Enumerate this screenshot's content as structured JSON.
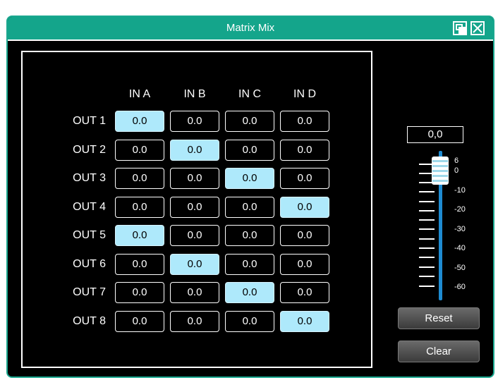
{
  "window": {
    "title": "Matrix Mix"
  },
  "columns": [
    "IN A",
    "IN B",
    "IN C",
    "IN D"
  ],
  "rows": [
    {
      "label": "OUT 1",
      "values": [
        "0.0",
        "0.0",
        "0.0",
        "0.0"
      ],
      "active": 0
    },
    {
      "label": "OUT 2",
      "values": [
        "0.0",
        "0.0",
        "0.0",
        "0.0"
      ],
      "active": 1
    },
    {
      "label": "OUT 3",
      "values": [
        "0.0",
        "0.0",
        "0.0",
        "0.0"
      ],
      "active": 2
    },
    {
      "label": "OUT 4",
      "values": [
        "0.0",
        "0.0",
        "0.0",
        "0.0"
      ],
      "active": 3
    },
    {
      "label": "OUT 5",
      "values": [
        "0.0",
        "0.0",
        "0.0",
        "0.0"
      ],
      "active": 0
    },
    {
      "label": "OUT 6",
      "values": [
        "0.0",
        "0.0",
        "0.0",
        "0.0"
      ],
      "active": 1
    },
    {
      "label": "OUT 7",
      "values": [
        "0.0",
        "0.0",
        "0.0",
        "0.0"
      ],
      "active": 2
    },
    {
      "label": "OUT 8",
      "values": [
        "0.0",
        "0.0",
        "0.0",
        "0.0"
      ],
      "active": 3
    }
  ],
  "fader": {
    "value_display": "0,0",
    "scale": [
      "6",
      "0",
      "-10",
      "-20",
      "-30",
      "-40",
      "-50",
      "-60"
    ]
  },
  "buttons": {
    "reset": "Reset",
    "clear": "Clear"
  },
  "colors": {
    "titlebar": "#14a58b",
    "active_cell": "#aee9fb",
    "fader_track": "#1e8bd1"
  }
}
